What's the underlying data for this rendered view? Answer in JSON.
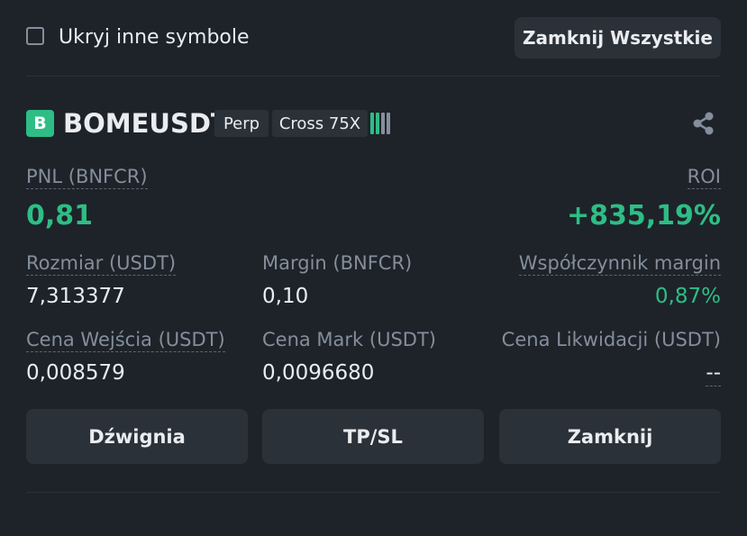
{
  "top": {
    "hide_others_label": "Ukryj inne symbole",
    "hide_others_checked": false,
    "close_all_label": "Zamknij Wszystkie"
  },
  "position": {
    "side_letter": "B",
    "symbol": "BOMEUSDT",
    "type_tag": "Perp",
    "margin_tag": "Cross 75X",
    "risk_bars_filled": 2,
    "risk_bars_total": 4,
    "pnl_label": "PNL (BNFCR)",
    "pnl_value": "0,81",
    "roi_label": "ROI",
    "roi_value": "+835,19%",
    "size_label": "Rozmiar (USDT)",
    "size_value": "7,313377",
    "margin_label": "Margin (BNFCR)",
    "margin_value": "0,10",
    "margin_ratio_label": "Współczynnik margin",
    "margin_ratio_value": "0,87%",
    "entry_price_label": "Cena Wejścia (USDT)",
    "entry_price_value": "0,008579",
    "mark_price_label": "Cena Mark (USDT)",
    "mark_price_value": "0,0096680",
    "liq_price_label": "Cena Likwidacji (USDT)",
    "liq_price_value": "--"
  },
  "actions": {
    "leverage_label": "Dźwignia",
    "tpsl_label": "TP/SL",
    "close_label": "Zamknij"
  },
  "icons": {
    "share": "share-icon"
  },
  "colors": {
    "background": "#1e2329",
    "button": "#2b3139",
    "green": "#2ebd85",
    "muted": "#848e9c",
    "text": "#eaecef"
  }
}
